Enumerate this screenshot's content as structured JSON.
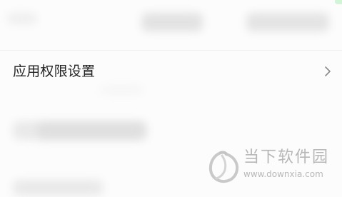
{
  "settings": {
    "items": [
      {
        "label": "应用权限设置"
      }
    ]
  },
  "watermark": {
    "site_name": "当下软件园",
    "url": "www.downxia.com",
    "logo_icon": "downxia-logo-icon"
  },
  "colors": {
    "text_primary": "#222222",
    "chevron": "#8a8a8a",
    "watermark": "#b7b7b7"
  }
}
